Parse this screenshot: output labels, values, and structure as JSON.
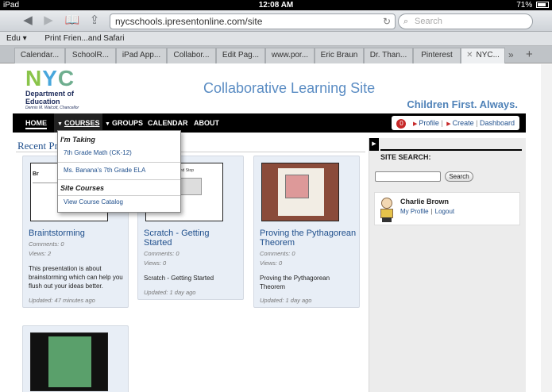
{
  "status_bar": {
    "device": "iPad",
    "time": "12:08 AM",
    "battery": "71%"
  },
  "browser": {
    "url": "nycschools.ipresentonline.com/site",
    "search_placeholder": "Search",
    "bookmarks": [
      "Edu ▾",
      "Print Frien...and Safari"
    ],
    "tabs": [
      "Calendar...",
      "SchoolR...",
      "iPad App...",
      "Collabor...",
      "Edit Pag...",
      "www.por...",
      "Eric Braun",
      "Dr. Than...",
      "Pinterest",
      "NYC..."
    ],
    "tabs_more": "»",
    "new_tab": "+"
  },
  "header": {
    "logo_letters": [
      "N",
      "Y",
      "C"
    ],
    "logo_org_line1": "Department of",
    "logo_org_line2": "Education",
    "logo_chancellor": "Dennis M. Walcott, Chancellor",
    "site_title": "Collaborative Learning Site",
    "tagline": "Children First.  Always."
  },
  "nav": {
    "home": "HOME",
    "courses": "COURSES",
    "groups": "GROUPS",
    "calendar": "CALENDAR",
    "about": "ABOUT",
    "notifications_count": "0",
    "profile": "Profile",
    "create": "Create",
    "dashboard": "Dashboard"
  },
  "dropdown": {
    "taking_heading": "I'm Taking",
    "course1": "7th Grade Math (CK-12)",
    "course2": "Ms. Banana's 7th Grade ELA",
    "site_heading": "Site Courses",
    "catalog": "View Course Catalog"
  },
  "recent": {
    "heading": "Recent Pr",
    "cards": [
      {
        "title": "Braintstorming",
        "comments": "Comments: 0",
        "views": "Views: 2",
        "description": "This presentation is about brainstorming which can help you flush out your ideas better.",
        "updated": "Updated: 47 minutes ago",
        "thumb_text": "Br"
      },
      {
        "title": "Scratch - Getting Started",
        "comments": "Comments: 0",
        "views": "Views: 0",
        "description": "Scratch - Getting Started",
        "updated": "Updated: 1 day ago",
        "thumb_text": "and Stop"
      },
      {
        "title": "Proving the Pythagorean Theorem",
        "comments": "Comments: 0",
        "views": "Views: 0",
        "description": "Proving the Pythagorean Theorem",
        "updated": "Updated: 1 day ago"
      }
    ]
  },
  "sidebar": {
    "title": "SITE SEARCH:",
    "search_button": "Search",
    "user_name": "Charlie Brown",
    "my_profile": "My Profile",
    "logout": "Logout"
  }
}
